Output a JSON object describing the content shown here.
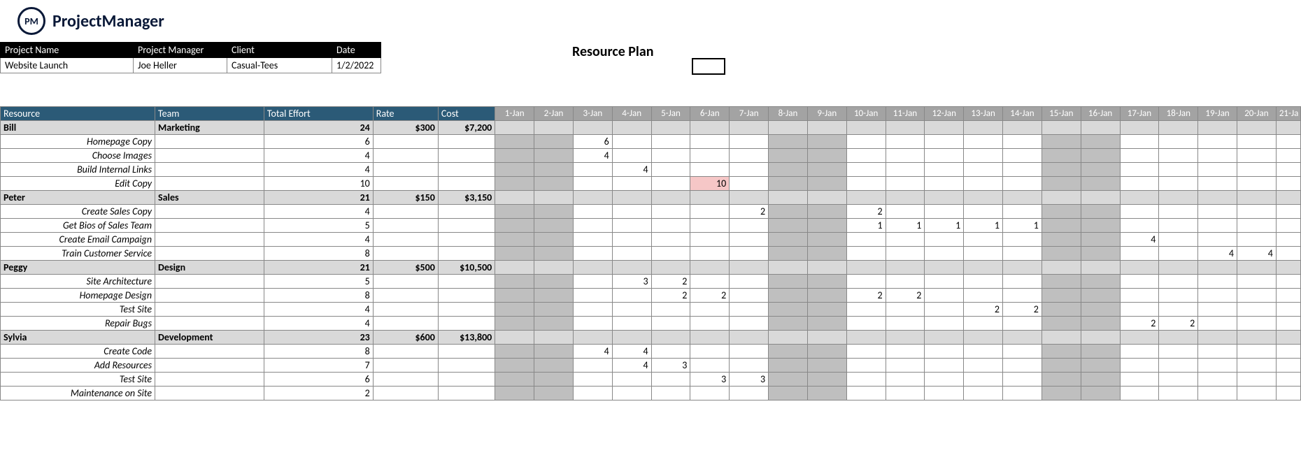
{
  "brand": {
    "logo_abbr": "PM",
    "logo_text": "ProjectManager"
  },
  "title": "Resource Plan",
  "meta": {
    "headers": {
      "project_name": "Project Name",
      "project_manager": "Project Manager",
      "client": "Client",
      "date": "Date"
    },
    "values": {
      "project_name": "Website Launch",
      "project_manager": "Joe Heller",
      "client": "Casual-Tees",
      "date": "1/2/2022"
    }
  },
  "columns": {
    "resource": "Resource",
    "team": "Team",
    "total_effort": "Total Effort",
    "rate": "Rate",
    "cost": "Cost"
  },
  "days": [
    "1-Jan",
    "2-Jan",
    "3-Jan",
    "4-Jan",
    "5-Jan",
    "6-Jan",
    "7-Jan",
    "8-Jan",
    "9-Jan",
    "10-Jan",
    "11-Jan",
    "12-Jan",
    "13-Jan",
    "14-Jan",
    "15-Jan",
    "16-Jan",
    "17-Jan",
    "18-Jan",
    "19-Jan",
    "20-Jan",
    "21-Ja"
  ],
  "weekend_idx": [
    0,
    1,
    7,
    8,
    14,
    15
  ],
  "groups": [
    {
      "resource": "Bill",
      "team": "Marketing",
      "total_effort": "24",
      "rate": "$300",
      "cost": "$7,200",
      "tasks": [
        {
          "name": "Homepage Copy",
          "effort": "6",
          "cells": {
            "2": "6"
          }
        },
        {
          "name": "Choose Images",
          "effort": "4",
          "cells": {
            "2": "4"
          }
        },
        {
          "name": "Build Internal Links",
          "effort": "4",
          "cells": {
            "3": "4"
          }
        },
        {
          "name": "Edit Copy",
          "effort": "10",
          "cells": {
            "5": "10"
          },
          "warn_idx": [
            5
          ]
        }
      ]
    },
    {
      "resource": "Peter",
      "team": "Sales",
      "total_effort": "21",
      "rate": "$150",
      "cost": "$3,150",
      "tasks": [
        {
          "name": "Create Sales Copy",
          "effort": "4",
          "cells": {
            "6": "2",
            "9": "2"
          }
        },
        {
          "name": "Get Bios of Sales Team",
          "effort": "5",
          "cells": {
            "9": "1",
            "10": "1",
            "11": "1",
            "12": "1",
            "13": "1"
          }
        },
        {
          "name": "Create Email Campaign",
          "effort": "4",
          "cells": {
            "16": "4"
          }
        },
        {
          "name": "Train Customer Service",
          "effort": "8",
          "cells": {
            "18": "4",
            "19": "4"
          }
        }
      ]
    },
    {
      "resource": "Peggy",
      "team": "Design",
      "total_effort": "21",
      "rate": "$500",
      "cost": "$10,500",
      "tasks": [
        {
          "name": "Site Architecture",
          "effort": "5",
          "cells": {
            "3": "3",
            "4": "2"
          }
        },
        {
          "name": "Homepage Design",
          "effort": "8",
          "cells": {
            "4": "2",
            "5": "2",
            "9": "2",
            "10": "2"
          }
        },
        {
          "name": "Test Site",
          "effort": "4",
          "cells": {
            "12": "2",
            "13": "2"
          }
        },
        {
          "name": "Repair Bugs",
          "effort": "4",
          "cells": {
            "16": "2",
            "17": "2"
          }
        }
      ]
    },
    {
      "resource": "Sylvia",
      "team": "Development",
      "total_effort": "23",
      "rate": "$600",
      "cost": "$13,800",
      "tasks": [
        {
          "name": "Create Code",
          "effort": "8",
          "cells": {
            "2": "4",
            "3": "4"
          }
        },
        {
          "name": "Add Resources",
          "effort": "7",
          "cells": {
            "3": "4",
            "4": "3"
          }
        },
        {
          "name": "Test Site",
          "effort": "6",
          "cells": {
            "5": "3",
            "6": "3"
          }
        },
        {
          "name": "Maintenance on Site",
          "effort": "2",
          "cells": {}
        }
      ]
    }
  ]
}
